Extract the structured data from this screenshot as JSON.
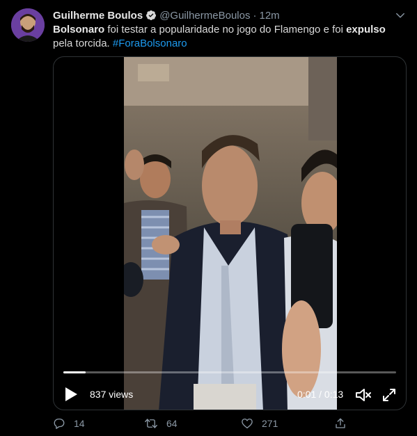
{
  "author": {
    "display_name": "Guilherme Boulos",
    "handle": "@GuilhermeBoulos",
    "separator": "·",
    "time": "12m",
    "verified": true,
    "avatar_icon": "user-avatar"
  },
  "tweet": {
    "bold_1": "Bolsonaro",
    "text_1": " foi testar a popularidade no jogo do Flamengo e foi ",
    "bold_2": "expulso",
    "text_2": " pela torcida. ",
    "hashtag": "#ForaBolsonaro"
  },
  "video": {
    "views": "837 views",
    "duration": "0:01 / 0:13",
    "progress": 0.067
  },
  "actions": {
    "reply_count": "14",
    "retweet_count": "64",
    "like_count": "271"
  },
  "colors": {
    "background": "#000000",
    "text": "#d9d9d9",
    "muted": "#8b98a5",
    "link": "#1d9bf0",
    "verified": "#d9d9d9"
  }
}
